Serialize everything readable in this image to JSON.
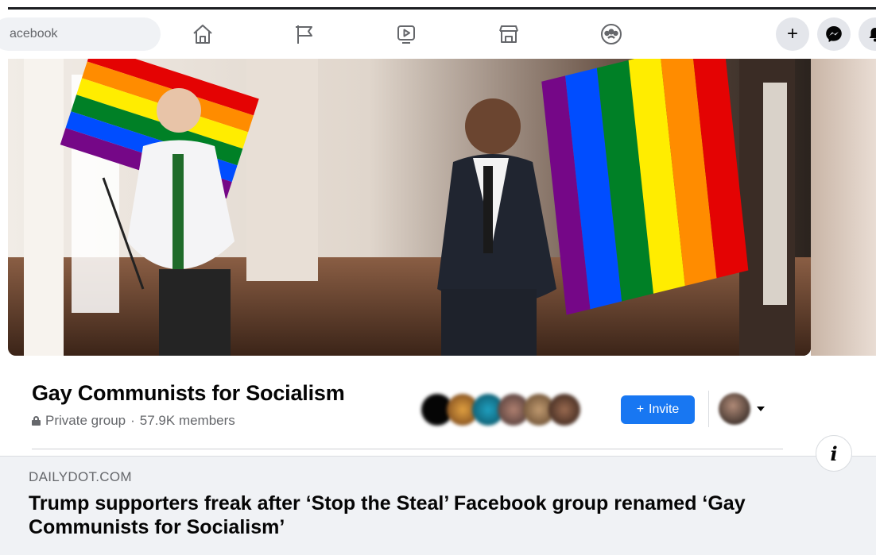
{
  "header": {
    "search_text": "acebook",
    "nav_icons": [
      "home-icon",
      "pages-flag-icon",
      "watch-video-icon",
      "marketplace-store-icon",
      "groups-icon"
    ],
    "right_buttons": [
      "create-plus-icon",
      "messenger-icon",
      "notifications-icon"
    ],
    "plus_glyph": "+"
  },
  "cover": {
    "description_colors": [
      "#e40303",
      "#ff8c00",
      "#ffed00",
      "#008026",
      "#004dff",
      "#750787"
    ]
  },
  "group": {
    "title": "Gay Communists for Socialism",
    "privacy": "Private group",
    "separator": "·",
    "members": "57.9K members",
    "invite_plus": "+",
    "invite_label": "Invite"
  },
  "link_card": {
    "domain": "DAILYDOT.COM",
    "headline": "Trump supporters freak after ‘Stop the Steal’ Facebook group renamed ‘Gay Communists for Socialism’",
    "info_glyph": "i"
  },
  "colors": {
    "accent": "#1877f2",
    "card_bg": "#f0f2f5",
    "text_primary": "#050505",
    "text_secondary": "#65676b"
  }
}
